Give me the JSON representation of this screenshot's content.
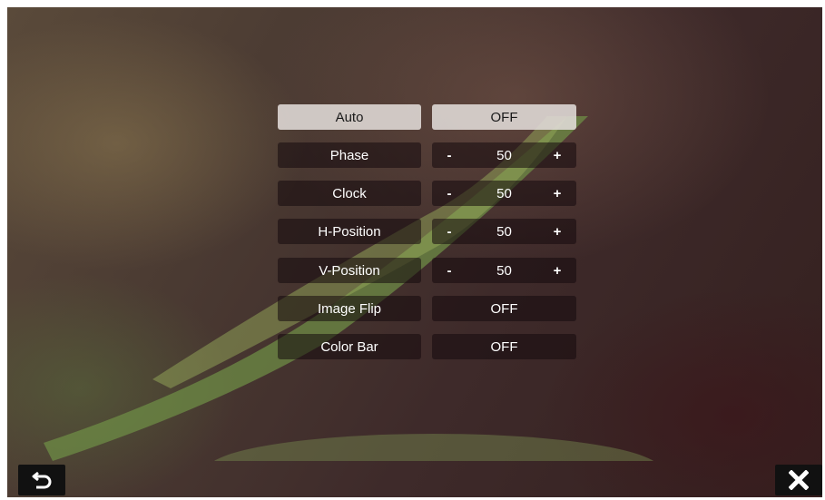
{
  "menu": {
    "rows": [
      {
        "label": "Auto",
        "value": "OFF"
      },
      {
        "label": "Phase",
        "minus": "-",
        "value": "50",
        "plus": "+"
      },
      {
        "label": "Clock",
        "minus": "-",
        "value": "50",
        "plus": "+"
      },
      {
        "label": "H-Position",
        "minus": "-",
        "value": "50",
        "plus": "+"
      },
      {
        "label": "V-Position",
        "minus": "-",
        "value": "50",
        "plus": "+"
      },
      {
        "label": "Image Flip",
        "value": "OFF"
      },
      {
        "label": "Color Bar",
        "value": "OFF"
      }
    ]
  },
  "icons": {
    "back": "return-arrow-icon",
    "close": "close-x-icon"
  }
}
